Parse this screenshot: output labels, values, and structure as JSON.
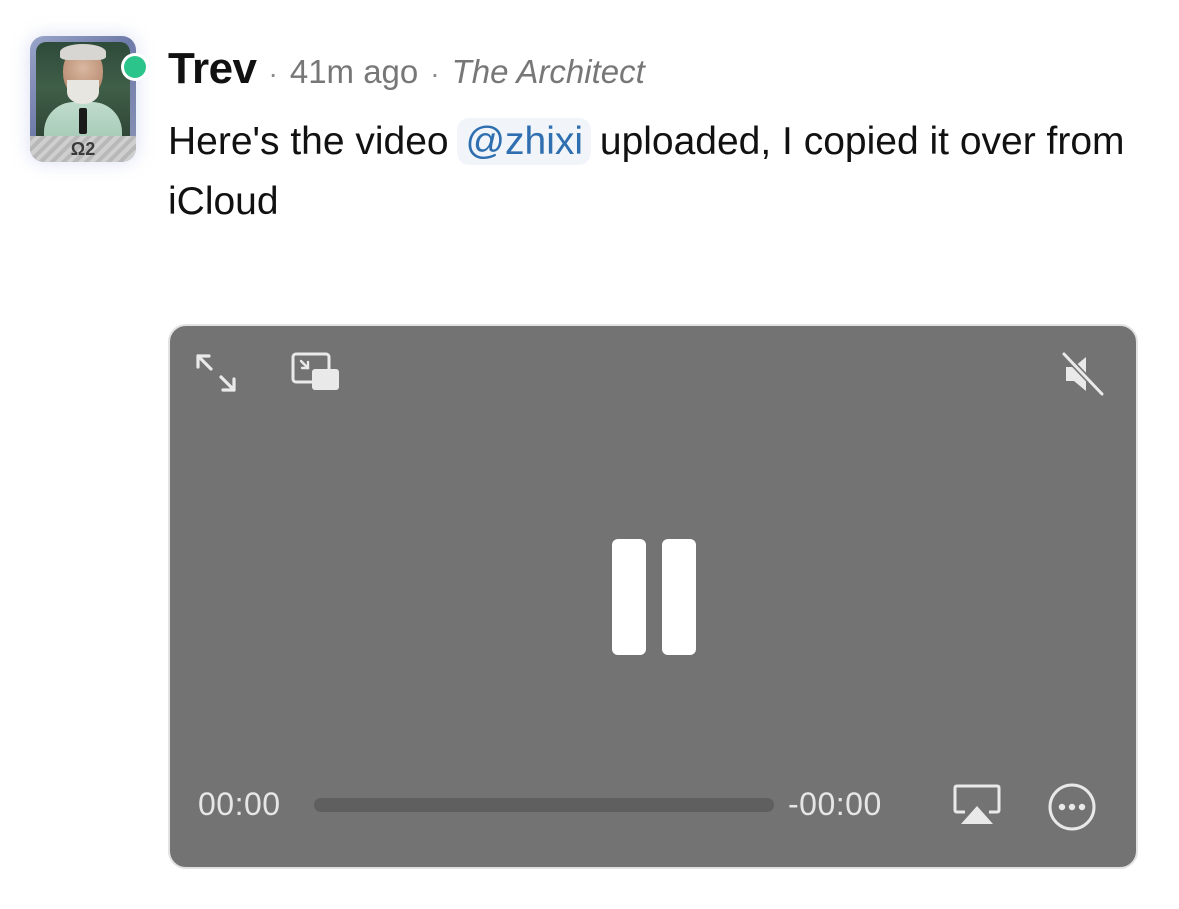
{
  "message": {
    "author": "Trev",
    "separator": "·",
    "time_ago": "41m ago",
    "role": "The Architect",
    "avatar_badge": "Ω2",
    "status": "online",
    "text_before": "Here's the video ",
    "mention": "@zhixi",
    "text_after": " uploaded, I copied it over from iCloud"
  },
  "player": {
    "current_time": "00:00",
    "remaining_time": "-00:00",
    "progress": 0,
    "state": "playing",
    "muted": true,
    "icons": {
      "fullscreen": "expand-arrows-icon",
      "pip": "picture-in-picture-icon",
      "mute": "speaker-muted-icon",
      "pause": "pause-icon",
      "airplay": "airplay-icon",
      "more": "ellipsis-circle-icon"
    }
  },
  "colors": {
    "player_bg": "#737373",
    "mention": "#2f6fb0",
    "presence": "#2bc48a",
    "meta_text": "#777777"
  }
}
